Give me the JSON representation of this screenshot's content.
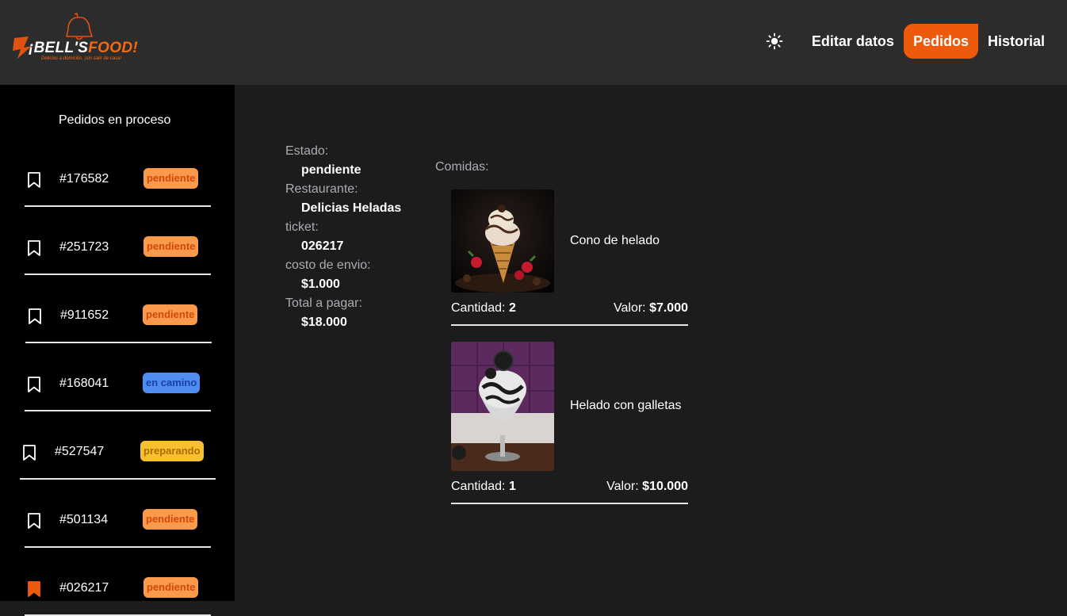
{
  "brand": {
    "name_part1": "¡BELL'S",
    "name_part2": "F",
    "name_part3": "OD!",
    "tagline": "Delicias a domicilio, ¡sin salir de casa!"
  },
  "nav": {
    "theme_icon": "sun-icon",
    "items": [
      {
        "label": "Editar datos",
        "active": false
      },
      {
        "label": "Pedidos",
        "active": true
      },
      {
        "label": "Historial",
        "active": false
      }
    ]
  },
  "sidebar": {
    "title": "Pedidos en proceso",
    "orders": [
      {
        "number": "#176582",
        "status": "pendiente",
        "selected": false
      },
      {
        "number": "#251723",
        "status": "pendiente",
        "selected": false
      },
      {
        "number": "#911652",
        "status": "pendiente",
        "selected": false
      },
      {
        "number": "#168041",
        "status": "en camino",
        "selected": false
      },
      {
        "number": "#527547",
        "status": "preparando",
        "selected": false
      },
      {
        "number": "#501134",
        "status": "pendiente",
        "selected": false
      },
      {
        "number": "#026217",
        "status": "pendiente",
        "selected": true
      }
    ]
  },
  "details": {
    "estado_label": "Estado:",
    "estado_value": "pendiente",
    "restaurante_label": "Restaurante:",
    "restaurante_value": "Delicias Heladas",
    "ticket_label": "ticket:",
    "ticket_value": "026217",
    "envio_label": "costo de envio:",
    "envio_value": "$1.000",
    "total_label": "Total a pagar:",
    "total_value": "$18.000"
  },
  "foods": {
    "label": "Comidas:",
    "items": [
      {
        "name": "Cono de helado",
        "qty_label": "Cantidad:",
        "qty": "2",
        "price_label": "Valor:",
        "price": "$7.000"
      },
      {
        "name": "Helado con galletas",
        "qty_label": "Cantidad:",
        "qty": "1",
        "price_label": "Valor:",
        "price": "$10.000"
      }
    ]
  },
  "colors": {
    "accent": "#ee5a0c",
    "header_bg": "#2c2c2c",
    "sidebar_bg": "#000000",
    "main_bg": "#1c1c1c",
    "pendiente": "#fb9a4a",
    "en_camino": "#4f8df0",
    "preparando": "#f6c02e"
  }
}
